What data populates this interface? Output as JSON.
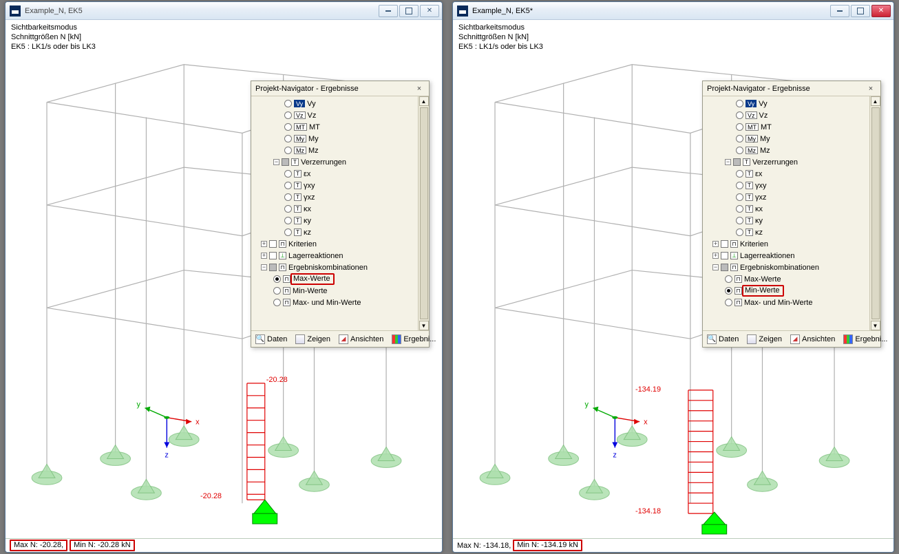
{
  "left": {
    "title": "Example_N, EK5",
    "legend": [
      "Sichtbarkeitsmodus",
      "Schnittgrößen N [kN]",
      "EK5 : LK1/s oder bis LK3"
    ],
    "value_top": "-20.28",
    "value_bottom": "-20.28",
    "status_max": "Max N: -20.28,",
    "status_min": "Min N: -20.28 kN"
  },
  "right": {
    "title": "Example_N, EK5*",
    "legend": [
      "Sichtbarkeitsmodus",
      "Schnittgrößen N [kN]",
      "EK5 : LK1/s oder bis LK3"
    ],
    "value_top": "-134.19",
    "value_bottom": "-134.18",
    "status_max": "Max N: -134.18,",
    "status_min": "Min N: -134.19 kN"
  },
  "axes": {
    "x": "x",
    "y": "y",
    "z": "z"
  },
  "panel": {
    "title": "Projekt-Navigator - Ergebnisse",
    "close": "×",
    "forces": [
      {
        "sym": "Vy",
        "label": "Vy",
        "selected": true
      },
      {
        "sym": "Vz",
        "label": "Vz"
      },
      {
        "sym": "MT",
        "label": "MT"
      },
      {
        "sym": "My",
        "label": "My"
      },
      {
        "sym": "Mz",
        "label": "Mz"
      }
    ],
    "distortions": {
      "label": "Verzerrungen",
      "items": [
        {
          "label": "εx"
        },
        {
          "label": "γxy"
        },
        {
          "label": "γxz"
        },
        {
          "label": "κx"
        },
        {
          "label": "κy"
        },
        {
          "label": "κz"
        }
      ]
    },
    "criteria": "Kriterien",
    "reactions": "Lagerreaktionen",
    "combinations": {
      "label": "Ergebniskombinationen",
      "items": [
        "Max-Werte",
        "Min-Werte",
        "Max- und Min-Werte"
      ]
    },
    "tabs": [
      "Daten",
      "Zeigen",
      "Ansichten",
      "Ergebni..."
    ]
  }
}
